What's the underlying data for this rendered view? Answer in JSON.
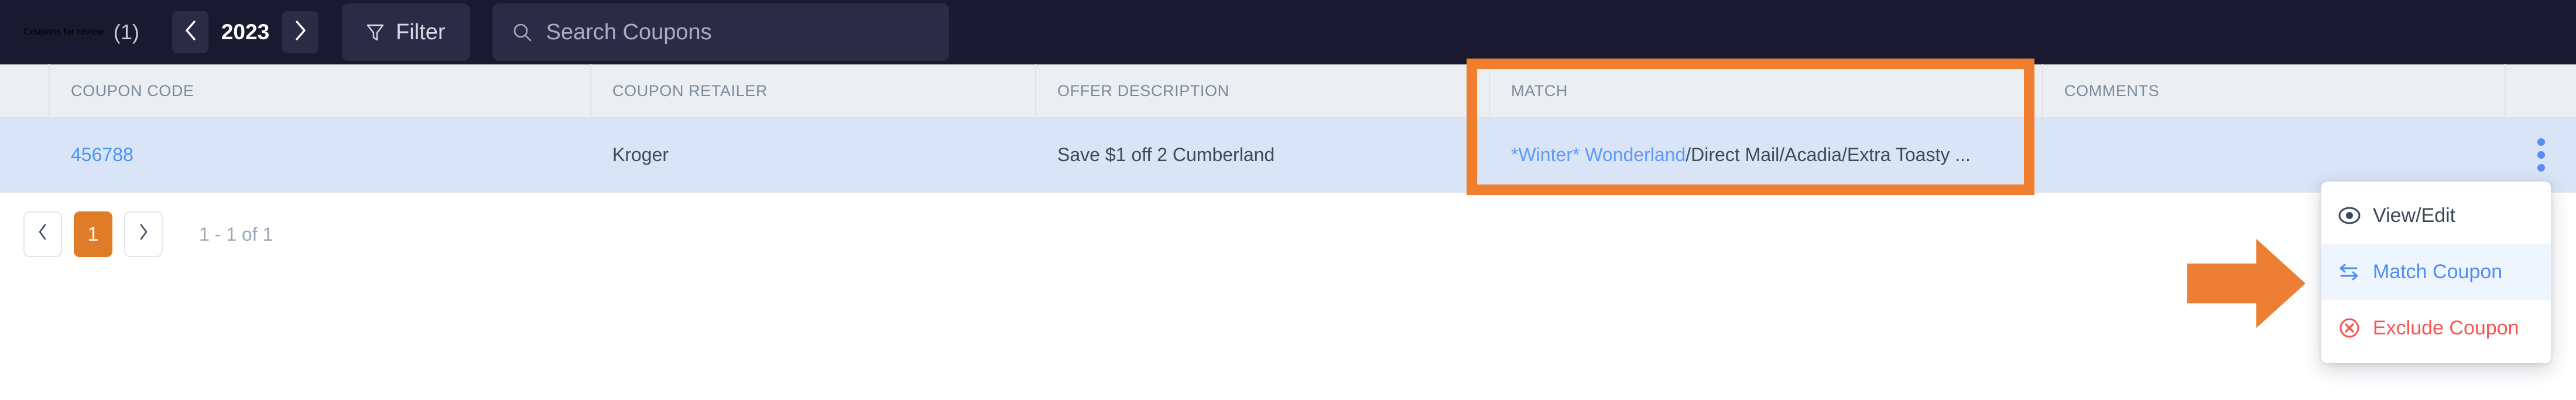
{
  "header": {
    "title": "Coupons for review",
    "count": "(1)",
    "year_prev_icon": "chevron-left-icon",
    "year": "2023",
    "year_next_icon": "chevron-right-icon",
    "filter_label": "Filter",
    "filter_icon": "funnel-icon",
    "search_icon": "search-icon",
    "search_placeholder": "Search Coupons",
    "search_value": ""
  },
  "table": {
    "columns": [
      {
        "key": "spacer",
        "label": ""
      },
      {
        "key": "coupon_code",
        "label": "COUPON CODE"
      },
      {
        "key": "coupon_retailer",
        "label": "COUPON RETAILER"
      },
      {
        "key": "offer_description",
        "label": "OFFER DESCRIPTION"
      },
      {
        "key": "match",
        "label": "MATCH"
      },
      {
        "key": "comments",
        "label": "COMMENTS"
      },
      {
        "key": "actions",
        "label": ""
      }
    ],
    "rows": [
      {
        "coupon_code": "456788",
        "coupon_retailer": "Kroger",
        "offer_description": "Save $1 off 2 Cumberland",
        "match_link": "*Winter* Wonderland",
        "match_rest": "/Direct Mail/Acadia/Extra Toasty ...",
        "comments": "",
        "actions_icon": "kebab-menu-icon"
      }
    ]
  },
  "pagination": {
    "prev_icon": "chevron-left-icon",
    "pages": [
      "1"
    ],
    "next_icon": "chevron-right-icon",
    "range_text": "1 - 1 of 1"
  },
  "context_menu": {
    "items": [
      {
        "label": "View/Edit",
        "icon": "eye-icon",
        "state": "default"
      },
      {
        "label": "Match Coupon",
        "icon": "swap-arrows-icon",
        "state": "highlighted"
      },
      {
        "label": "Exclude Coupon",
        "icon": "circle-x-icon",
        "state": "danger"
      }
    ]
  },
  "annotations": {
    "highlight_box_color": "#ef7f2e",
    "arrow_color": "#ec7f33",
    "arrow_icon": "right-arrow-annotation"
  },
  "colors": {
    "topbar_bg": "#191930",
    "table_header_bg": "#eceff2",
    "row_selected_bg": "#d9e4f7",
    "link_blue": "#4c93f0",
    "accent_orange": "#e07b27",
    "danger_red": "#f6564f"
  }
}
